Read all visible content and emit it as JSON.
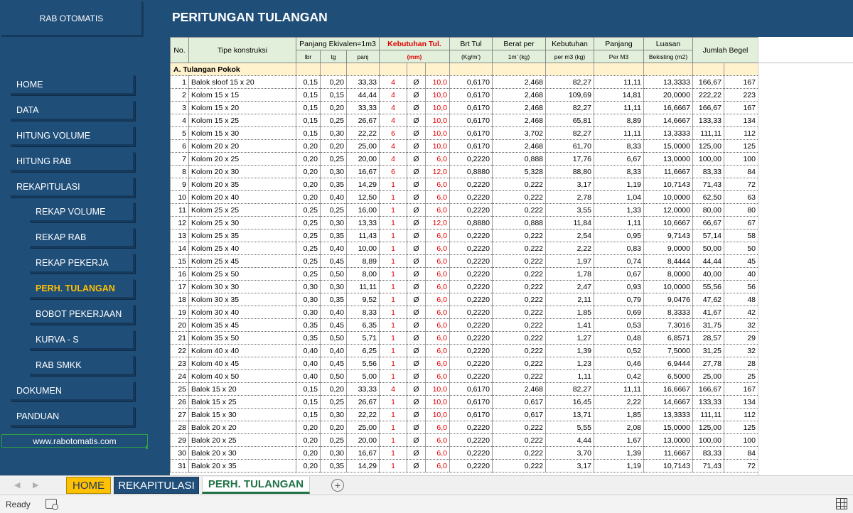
{
  "sidebar": {
    "title": "RAB OTOMATIS",
    "items": [
      {
        "label": "HOME",
        "level": "main"
      },
      {
        "label": "DATA",
        "level": "main"
      },
      {
        "label": "HITUNG VOLUME",
        "level": "main"
      },
      {
        "label": "HITUNG RAB",
        "level": "main"
      },
      {
        "label": "REKAPITULASI",
        "level": "main"
      },
      {
        "label": "REKAP VOLUME",
        "level": "sub"
      },
      {
        "label": "REKAP RAB",
        "level": "sub"
      },
      {
        "label": "REKAP PEKERJA",
        "level": "sub"
      },
      {
        "label": "PERH. TULANGAN",
        "level": "sub",
        "active": true
      },
      {
        "label": "BOBOT PEKERJAAN",
        "level": "sub"
      },
      {
        "label": "KURVA - S",
        "level": "sub"
      },
      {
        "label": "RAB SMKK",
        "level": "sub"
      },
      {
        "label": "DOKUMEN",
        "level": "main"
      },
      {
        "label": "PANDUAN",
        "level": "main"
      }
    ],
    "website": "www.rabotomatis.com"
  },
  "header": {
    "title": "PERITUNGAN TULANGAN"
  },
  "table": {
    "headers": {
      "no": "No.",
      "tipe": "Tipe konstruksi",
      "panjang_ek": "Panjang Ekivalen=1m3",
      "lbr": "lbr",
      "tg": "tg",
      "panj": "panj",
      "kebutuhan_tul": "Kebutuhan Tul.",
      "mm": "(mm)",
      "brt_tul": "Brt Tul",
      "kgm": "(Kg/m')",
      "berat_per": "Berat per",
      "berat_unit": "1m'  (kg)",
      "kebutuhan": "Kebutuhan",
      "keb_unit": "per m3 (kg)",
      "panjang": "Panjang",
      "panj_unit": "Per M3",
      "luasan": "Luasan",
      "luas_unit": "Bekisting (m2)",
      "jumlah_begel": "Jumlah Begel"
    },
    "section": {
      "code": "A.",
      "label": "Tulangan Pokok"
    },
    "rows": [
      [
        "1",
        "Balok sloof  15 x 20",
        "0,15",
        "0,20",
        "33,33",
        "4",
        "Ø",
        "10,0",
        "0,6170",
        "2,468",
        "82,27",
        "11,11",
        "13,3333",
        "166,67",
        "167"
      ],
      [
        "2",
        "Kolom 15 x 15",
        "0,15",
        "0,15",
        "44,44",
        "4",
        "Ø",
        "10,0",
        "0,6170",
        "2,468",
        "109,69",
        "14,81",
        "20,0000",
        "222,22",
        "223"
      ],
      [
        "3",
        "Kolom 15 x 20",
        "0,15",
        "0,20",
        "33,33",
        "4",
        "Ø",
        "10,0",
        "0,6170",
        "2,468",
        "82,27",
        "11,11",
        "16,6667",
        "166,67",
        "167"
      ],
      [
        "4",
        "Kolom 15 x 25",
        "0,15",
        "0,25",
        "26,67",
        "4",
        "Ø",
        "10,0",
        "0,6170",
        "2,468",
        "65,81",
        "8,89",
        "14,6667",
        "133,33",
        "134"
      ],
      [
        "5",
        "Kolom 15 x 30",
        "0,15",
        "0,30",
        "22,22",
        "6",
        "Ø",
        "10,0",
        "0,6170",
        "3,702",
        "82,27",
        "11,11",
        "13,3333",
        "111,11",
        "112"
      ],
      [
        "6",
        "Kolom 20 x 20",
        "0,20",
        "0,20",
        "25,00",
        "4",
        "Ø",
        "10,0",
        "0,6170",
        "2,468",
        "61,70",
        "8,33",
        "15,0000",
        "125,00",
        "125"
      ],
      [
        "7",
        "Kolom 20 x 25",
        "0,20",
        "0,25",
        "20,00",
        "4",
        "Ø",
        "6,0",
        "0,2220",
        "0,888",
        "17,76",
        "6,67",
        "13,0000",
        "100,00",
        "100"
      ],
      [
        "8",
        "Kolom 20 x 30",
        "0,20",
        "0,30",
        "16,67",
        "6",
        "Ø",
        "12,0",
        "0,8880",
        "5,328",
        "88,80",
        "8,33",
        "11,6667",
        "83,33",
        "84"
      ],
      [
        "9",
        "Kolom 20 x 35",
        "0,20",
        "0,35",
        "14,29",
        "1",
        "Ø",
        "6,0",
        "0,2220",
        "0,222",
        "3,17",
        "1,19",
        "10,7143",
        "71,43",
        "72"
      ],
      [
        "10",
        "Kolom 20 x 40",
        "0,20",
        "0,40",
        "12,50",
        "1",
        "Ø",
        "6,0",
        "0,2220",
        "0,222",
        "2,78",
        "1,04",
        "10,0000",
        "62,50",
        "63"
      ],
      [
        "11",
        "Kolom 25 x 25",
        "0,25",
        "0,25",
        "16,00",
        "1",
        "Ø",
        "6,0",
        "0,2220",
        "0,222",
        "3,55",
        "1,33",
        "12,0000",
        "80,00",
        "80"
      ],
      [
        "12",
        "Kolom 25 x 30",
        "0,25",
        "0,30",
        "13,33",
        "1",
        "Ø",
        "12,0",
        "0,8880",
        "0,888",
        "11,84",
        "1,11",
        "10,6667",
        "66,67",
        "67"
      ],
      [
        "13",
        "Kolom 25 x 35",
        "0,25",
        "0,35",
        "11,43",
        "1",
        "Ø",
        "6,0",
        "0,2220",
        "0,222",
        "2,54",
        "0,95",
        "9,7143",
        "57,14",
        "58"
      ],
      [
        "14",
        "Kolom 25 x 40",
        "0,25",
        "0,40",
        "10,00",
        "1",
        "Ø",
        "6,0",
        "0,2220",
        "0,222",
        "2,22",
        "0,83",
        "9,0000",
        "50,00",
        "50"
      ],
      [
        "15",
        "Kolom 25 x 45",
        "0,25",
        "0,45",
        "8,89",
        "1",
        "Ø",
        "6,0",
        "0,2220",
        "0,222",
        "1,97",
        "0,74",
        "8,4444",
        "44,44",
        "45"
      ],
      [
        "16",
        "Kolom 25 x 50",
        "0,25",
        "0,50",
        "8,00",
        "1",
        "Ø",
        "6,0",
        "0,2220",
        "0,222",
        "1,78",
        "0,67",
        "8,0000",
        "40,00",
        "40"
      ],
      [
        "17",
        "Kolom 30 x 30",
        "0,30",
        "0,30",
        "11,11",
        "1",
        "Ø",
        "6,0",
        "0,2220",
        "0,222",
        "2,47",
        "0,93",
        "10,0000",
        "55,56",
        "56"
      ],
      [
        "18",
        "Kolom 30 x 35",
        "0,30",
        "0,35",
        "9,52",
        "1",
        "Ø",
        "6,0",
        "0,2220",
        "0,222",
        "2,11",
        "0,79",
        "9,0476",
        "47,62",
        "48"
      ],
      [
        "19",
        "Kolom 30 x 40",
        "0,30",
        "0,40",
        "8,33",
        "1",
        "Ø",
        "6,0",
        "0,2220",
        "0,222",
        "1,85",
        "0,69",
        "8,3333",
        "41,67",
        "42"
      ],
      [
        "20",
        "Kolom 35 x 45",
        "0,35",
        "0,45",
        "6,35",
        "1",
        "Ø",
        "6,0",
        "0,2220",
        "0,222",
        "1,41",
        "0,53",
        "7,3016",
        "31,75",
        "32"
      ],
      [
        "21",
        "Kolom 35 x 50",
        "0,35",
        "0,50",
        "5,71",
        "1",
        "Ø",
        "6,0",
        "0,2220",
        "0,222",
        "1,27",
        "0,48",
        "6,8571",
        "28,57",
        "29"
      ],
      [
        "22",
        "Kolom 40 x 40",
        "0,40",
        "0,40",
        "6,25",
        "1",
        "Ø",
        "6,0",
        "0,2220",
        "0,222",
        "1,39",
        "0,52",
        "7,5000",
        "31,25",
        "32"
      ],
      [
        "23",
        "Kolom 40 x 45",
        "0,40",
        "0,45",
        "5,56",
        "1",
        "Ø",
        "6,0",
        "0,2220",
        "0,222",
        "1,23",
        "0,46",
        "6,9444",
        "27,78",
        "28"
      ],
      [
        "24",
        "Kolom 40 x 50",
        "0,40",
        "0,50",
        "5,00",
        "1",
        "Ø",
        "6,0",
        "0,2220",
        "0,222",
        "1,11",
        "0,42",
        "6,5000",
        "25,00",
        "25"
      ],
      [
        "25",
        "Balok 15 x 20",
        "0,15",
        "0,20",
        "33,33",
        "4",
        "Ø",
        "10,0",
        "0,6170",
        "2,468",
        "82,27",
        "11,11",
        "16,6667",
        "166,67",
        "167"
      ],
      [
        "26",
        "Balok 15 x 25",
        "0,15",
        "0,25",
        "26,67",
        "1",
        "Ø",
        "10,0",
        "0,6170",
        "0,617",
        "16,45",
        "2,22",
        "14,6667",
        "133,33",
        "134"
      ],
      [
        "27",
        "Balok 15 x 30",
        "0,15",
        "0,30",
        "22,22",
        "1",
        "Ø",
        "10,0",
        "0,6170",
        "0,617",
        "13,71",
        "1,85",
        "13,3333",
        "111,11",
        "112"
      ],
      [
        "28",
        "Balok 20 x 20",
        "0,20",
        "0,20",
        "25,00",
        "1",
        "Ø",
        "6,0",
        "0,2220",
        "0,222",
        "5,55",
        "2,08",
        "15,0000",
        "125,00",
        "125"
      ],
      [
        "29",
        "Balok 20 x 25",
        "0,20",
        "0,25",
        "20,00",
        "1",
        "Ø",
        "6,0",
        "0,2220",
        "0,222",
        "4,44",
        "1,67",
        "13,0000",
        "100,00",
        "100"
      ],
      [
        "30",
        "Balok  20 x 30",
        "0,20",
        "0,30",
        "16,67",
        "1",
        "Ø",
        "6,0",
        "0,2220",
        "0,222",
        "3,70",
        "1,39",
        "11,6667",
        "83,33",
        "84"
      ],
      [
        "31",
        "Balok  20 x 35",
        "0,20",
        "0,35",
        "14,29",
        "1",
        "Ø",
        "6,0",
        "0,2220",
        "0,222",
        "3,17",
        "1,19",
        "10,7143",
        "71,43",
        "72"
      ]
    ]
  },
  "sheet_tabs": [
    {
      "label": "HOME"
    },
    {
      "label": "REKAPITULASI"
    },
    {
      "label": "PERH. TULANGAN",
      "active": true
    }
  ],
  "add_sheet": "+",
  "status": {
    "text": "Ready"
  },
  "colors": {
    "brand": "#1f4e79",
    "accent": "#ffc000",
    "header_fill": "#e2efda",
    "section_fill": "#fff2cc",
    "red": "#e00000",
    "active_tab": "#1e7145"
  }
}
